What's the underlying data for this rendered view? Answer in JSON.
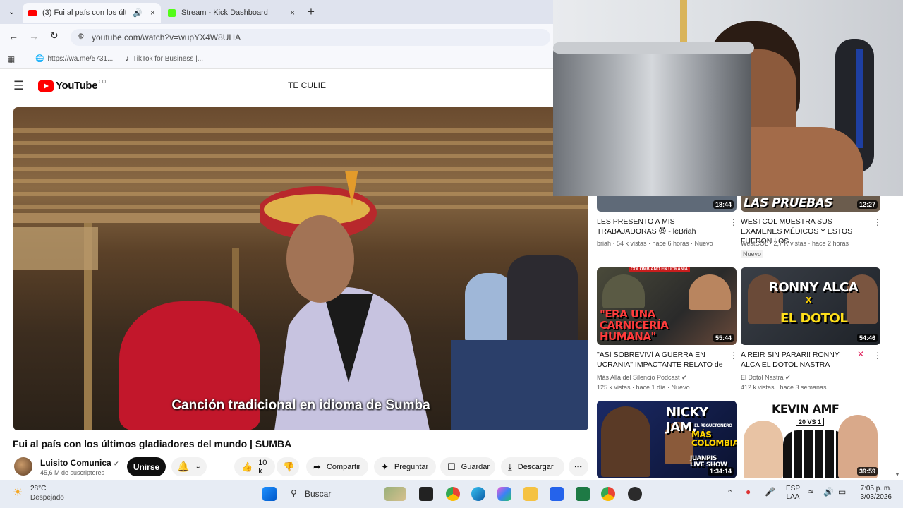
{
  "browser": {
    "tabs": [
      {
        "label": "(3) Fui al país con los últim",
        "active": true
      },
      {
        "label": "Stream - Kick Dashboard",
        "active": false
      }
    ],
    "new_tab": "+",
    "tab_close": "×",
    "url": "youtube.com/watch?v=wupYX4W8UHA",
    "bookmarks": [
      "https://wa.me/5731...",
      "TikTok for Business |..."
    ]
  },
  "youtube": {
    "logo": "YouTube",
    "logo_region": "CO",
    "search_query": "TE CULIE",
    "video": {
      "subtitle": "Canción tradicional en idioma de Sumba",
      "title": "Fui al país con los últimos gladiadores del mundo | SUMBA"
    },
    "channel": {
      "name": "Luisito Comunica",
      "subscribers": "45,6 M de suscriptores",
      "join_label": "Unirse"
    },
    "actions": {
      "likes": "10 k",
      "share": "Compartir",
      "ask": "Preguntar",
      "save": "Guardar",
      "download": "Descargar"
    }
  },
  "recommendations": [
    {
      "title": "LES PRESENTO A MIS TRABAJADORAS 😈 - leBriah",
      "meta1": "briah · 54 k vistas · hace 6 horas · Nuevo",
      "duration": "18:44"
    },
    {
      "title": "WESTCOL MUESTRA SUS EXAMENES MÉDICOS Y ESTOS FUERON LOS ...",
      "meta1": "WestCOL · 2,7 K vistas · hace 2 horas",
      "meta2": "Nuevo",
      "duration": "12:27",
      "thumb_text": "LAS PRUEBAS"
    },
    {
      "title": "\"ASÍ SOBREVIVÍ A GUERRA EN UCRANIA\" IMPACTANTE RELATO de ...",
      "meta1": "Más Allá del Silencio Podcast",
      "meta2": "125 k vistas · hace 1 día · Nuevo",
      "duration": "55:44",
      "thumb_text": "\"ERA UNA CARNICERÍA HUMANA\"",
      "thumb_banner": "COLOMBIANO EN UCRANIA"
    },
    {
      "title": "A REIR SIN PARAR!! RONNY ALCA EL DOTOL NASTRA",
      "meta1": "El Dotol Nastra",
      "meta2": "412 k vistas · hace 3 semanas",
      "duration": "54:46",
      "thumb_text_1": "RONNY ALCA",
      "thumb_text_2": "X",
      "thumb_text_3": "EL DOTOL"
    },
    {
      "title": "",
      "duration": "1:34:14",
      "thumb_text_1": "NICKY JAM,",
      "thumb_text_2": "EL REGUETONERO",
      "thumb_text_3": "MÁS COLOMBIANO",
      "thumb_text_4": "JUANPIS LIVE SHOW"
    },
    {
      "title": "",
      "duration": "39:59",
      "thumb_text_1": "KEVIN AMF",
      "thumb_text_2": "20 VS 1"
    }
  ],
  "taskbar": {
    "temperature": "28°C",
    "weather": "Despejado",
    "search": "Buscar",
    "lang1": "ESP",
    "lang2": "LAA",
    "time": "7:05 p. m.",
    "date": "3/03/2026"
  },
  "colors": {
    "youtube_red": "#ff0000",
    "kick_green": "#53fc18"
  }
}
